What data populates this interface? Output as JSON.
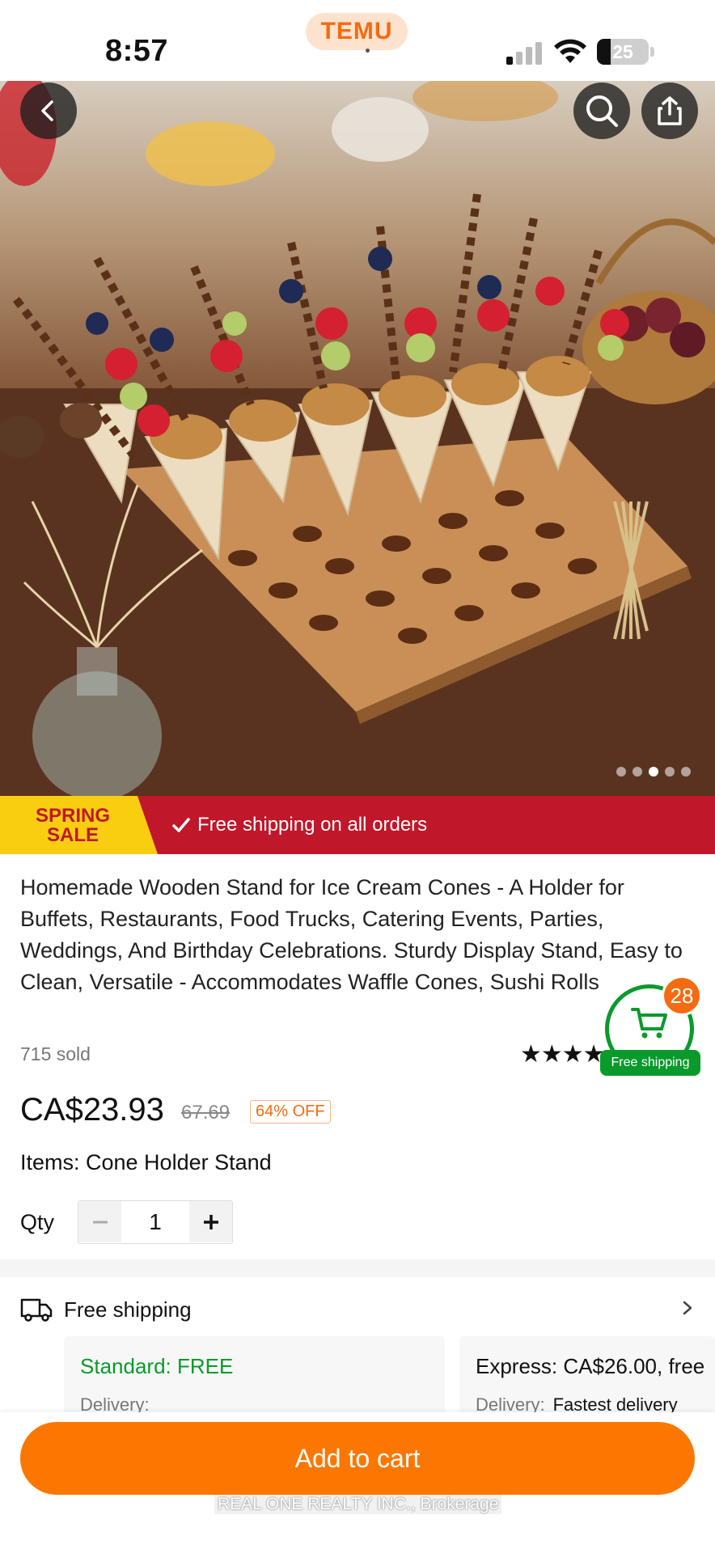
{
  "status_bar": {
    "time": "8:57",
    "app_pill": "TEMU",
    "battery": "25"
  },
  "product": {
    "title": "Homemade Wooden Stand for Ice Cream Cones - A Holder for Buffets, Restaurants, Food Trucks, Catering Events, Parties, Weddings, And Birthday Celebrations. Sturdy Display Stand, Easy to Clean, Versatile - Accommodates Waffle Cones, Sushi Rolls",
    "sold": "715 sold",
    "rating_stars": "★★★★",
    "price": "CA$23.93",
    "original_price": "67.69",
    "discount": "64% OFF",
    "items_label": "Items: Cone Holder Stand",
    "qty_label": "Qty",
    "qty_value": "1",
    "image_count": 5,
    "image_index": 3
  },
  "banner": {
    "sale_line1": "SPRING",
    "sale_line2": "SALE",
    "text": "Free shipping on all orders"
  },
  "cart_float": {
    "count": "28",
    "label": "Free shipping"
  },
  "shipping": {
    "title": "Free shipping",
    "options": [
      {
        "name": "Standard: FREE",
        "sub": "Delivery:",
        "value": ""
      },
      {
        "name": "Express: CA$26.00, free",
        "sub": "Delivery:",
        "value": "Fastest delivery"
      }
    ]
  },
  "bottom": {
    "add_to_cart": "Add to cart",
    "watermark": "REAL ONE REALTY INC., Brokerage"
  },
  "colors": {
    "accent": "#fb7701",
    "banner_red": "#c0172a",
    "sale_yellow": "#f9cd10",
    "green": "#0a9a2b"
  }
}
